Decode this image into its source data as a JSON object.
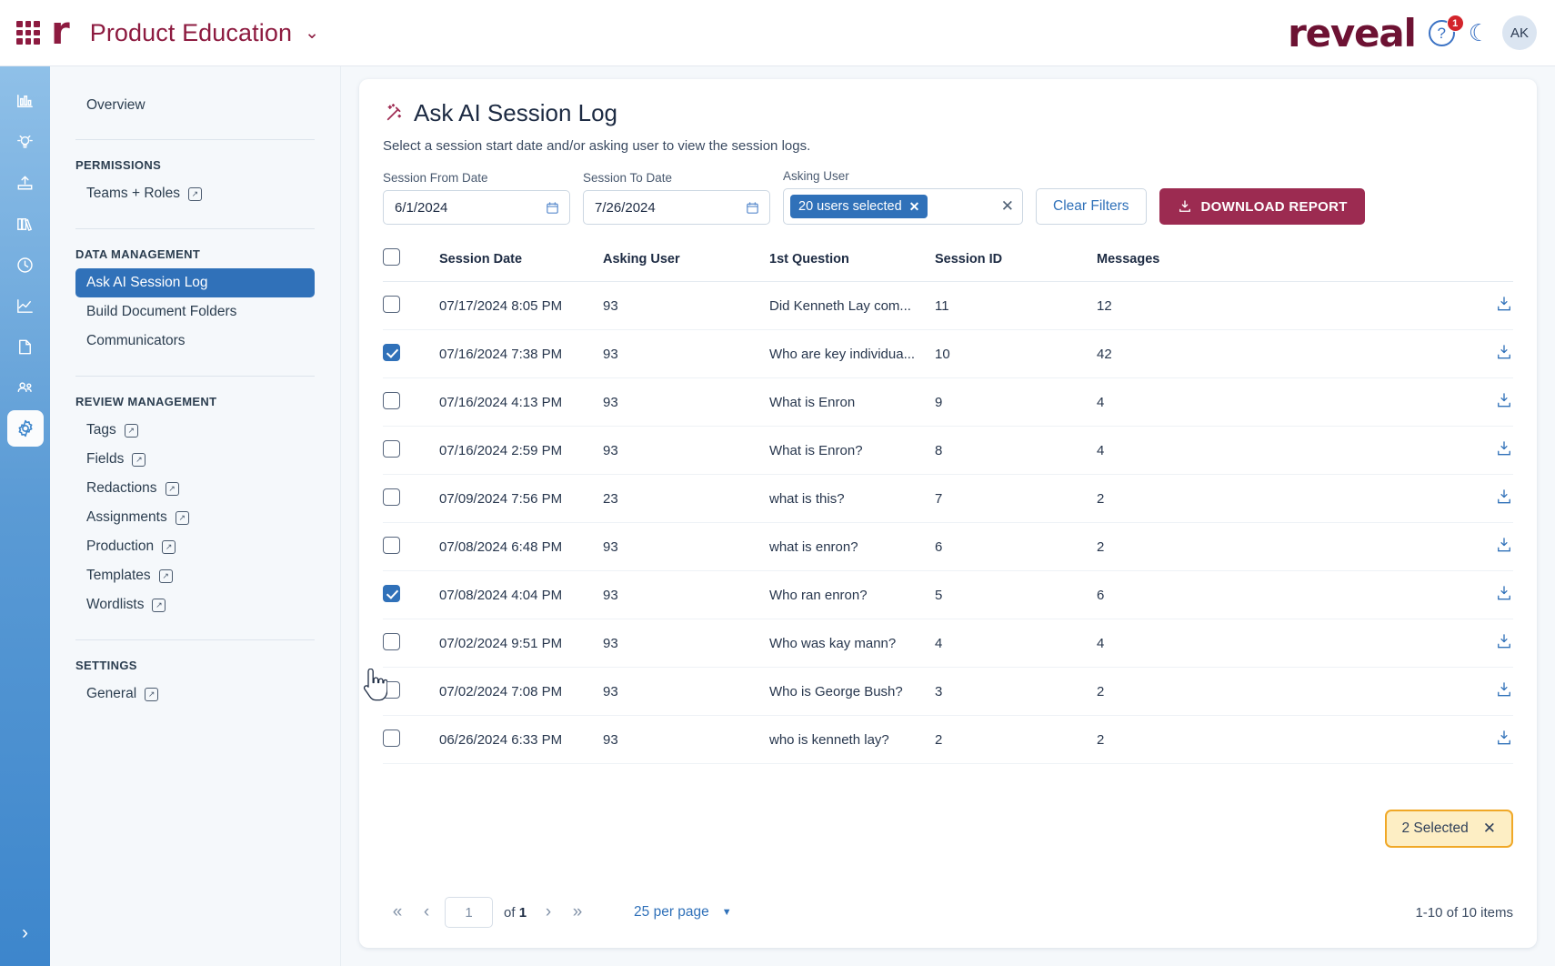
{
  "topbar": {
    "apps_icon": "grid-apps-icon",
    "brand_mark": "r",
    "project_title": "Product Education",
    "project_caret": "⌄",
    "logo": "reveal",
    "help_icon": "?",
    "help_badge": "1",
    "theme_icon": "dark-mode-moon-icon",
    "avatar_initials": "AK"
  },
  "rail": {
    "items": [
      {
        "name": "dashboard-icon"
      },
      {
        "name": "insights-icon"
      },
      {
        "name": "upload-icon"
      },
      {
        "name": "library-icon"
      },
      {
        "name": "history-icon"
      },
      {
        "name": "analytics-icon"
      },
      {
        "name": "documents-icon"
      },
      {
        "name": "users-icon"
      },
      {
        "name": "settings-icon"
      }
    ],
    "expand_icon": "›"
  },
  "sidebar": {
    "overview": "Overview",
    "sections": [
      {
        "heading": "PERMISSIONS",
        "items": [
          {
            "label": "Teams + Roles",
            "external": true,
            "selected": false
          }
        ]
      },
      {
        "heading": "DATA MANAGEMENT",
        "items": [
          {
            "label": "Ask AI Session Log",
            "external": false,
            "selected": true
          },
          {
            "label": "Build Document Folders",
            "external": false,
            "selected": false
          },
          {
            "label": "Communicators",
            "external": false,
            "selected": false
          }
        ]
      },
      {
        "heading": "REVIEW MANAGEMENT",
        "items": [
          {
            "label": "Tags",
            "external": true,
            "selected": false
          },
          {
            "label": "Fields",
            "external": true,
            "selected": false
          },
          {
            "label": "Redactions",
            "external": true,
            "selected": false
          },
          {
            "label": "Assignments",
            "external": true,
            "selected": false
          },
          {
            "label": "Production",
            "external": true,
            "selected": false
          },
          {
            "label": "Templates",
            "external": true,
            "selected": false
          },
          {
            "label": "Wordlists",
            "external": true,
            "selected": false
          }
        ]
      },
      {
        "heading": "SETTINGS",
        "items": [
          {
            "label": "General",
            "external": true,
            "selected": false
          }
        ]
      }
    ]
  },
  "page": {
    "title": "Ask AI Session Log",
    "title_icon": "magic-wand-icon",
    "subtitle": "Select a session start date and/or asking user to view the session logs."
  },
  "filters": {
    "from_label": "Session From Date",
    "from_value": "6/1/2024",
    "to_label": "Session To Date",
    "to_value": "7/26/2024",
    "user_label": "Asking User",
    "user_chip": "20 users selected",
    "chip_remove": "✕",
    "clear_all": "✕",
    "clear_filters_label": "Clear Filters",
    "download_label": "DOWNLOAD REPORT"
  },
  "table": {
    "columns": [
      "Session Date",
      "Asking User",
      "1st Question",
      "Session ID",
      "Messages"
    ],
    "header_checkbox_checked": false,
    "rows": [
      {
        "checked": false,
        "date": "07/17/2024 8:05 PM",
        "user": "93",
        "question": "Did Kenneth Lay com...",
        "session_id": "11",
        "messages": "12"
      },
      {
        "checked": true,
        "date": "07/16/2024 7:38 PM",
        "user": "93",
        "question": "Who are key individua...",
        "session_id": "10",
        "messages": "42"
      },
      {
        "checked": false,
        "date": "07/16/2024 4:13 PM",
        "user": "93",
        "question": "What is Enron",
        "session_id": "9",
        "messages": "4"
      },
      {
        "checked": false,
        "date": "07/16/2024 2:59 PM",
        "user": "93",
        "question": "What is Enron?",
        "session_id": "8",
        "messages": "4"
      },
      {
        "checked": false,
        "date": "07/09/2024 7:56 PM",
        "user": "23",
        "question": "what is this?",
        "session_id": "7",
        "messages": "2"
      },
      {
        "checked": false,
        "date": "07/08/2024 6:48 PM",
        "user": "93",
        "question": "what is enron?",
        "session_id": "6",
        "messages": "2"
      },
      {
        "checked": true,
        "date": "07/08/2024 4:04 PM",
        "user": "93",
        "question": "Who ran enron?",
        "session_id": "5",
        "messages": "6"
      },
      {
        "checked": false,
        "date": "07/02/2024 9:51 PM",
        "user": "93",
        "question": "Who was kay mann?",
        "session_id": "4",
        "messages": "4"
      },
      {
        "checked": false,
        "date": "07/02/2024 7:08 PM",
        "user": "93",
        "question": "Who is George Bush?",
        "session_id": "3",
        "messages": "2"
      },
      {
        "checked": false,
        "date": "06/26/2024 6:33 PM",
        "user": "93",
        "question": "who is kenneth lay?",
        "session_id": "2",
        "messages": "2"
      }
    ],
    "row_download_icon": "download-icon"
  },
  "selection_badge": {
    "label": "2 Selected",
    "close": "✕"
  },
  "footer": {
    "first_icon": "«",
    "prev_icon": "‹",
    "page_value": "1",
    "of_text_prefix": "of",
    "total_pages": "1",
    "next_icon": "›",
    "last_icon": "»",
    "per_page_label": "25 per page",
    "per_page_caret": "▼",
    "item_count": "1-10 of 10 items"
  },
  "colors": {
    "brand_maroon": "#8d1b40",
    "accent_blue": "#3071b9",
    "download_button": "#9c2b51",
    "selection_amber_border": "#f0a827",
    "selection_amber_fill": "#fdeec4"
  }
}
